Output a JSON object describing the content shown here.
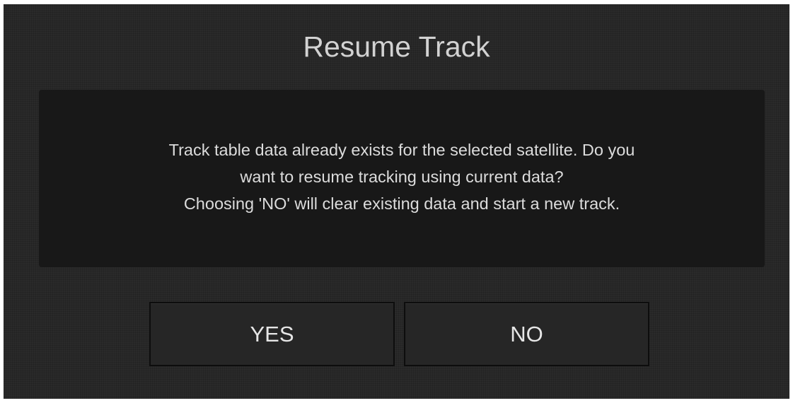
{
  "dialog": {
    "title": "Resume Track",
    "message": {
      "line1": "Track table data already exists for the selected satellite. Do you",
      "line2": "want to resume tracking using current data?",
      "line3": "Choosing 'NO' will clear existing data and start a new track."
    },
    "buttons": {
      "yes_label": "YES",
      "no_label": "NO"
    }
  }
}
